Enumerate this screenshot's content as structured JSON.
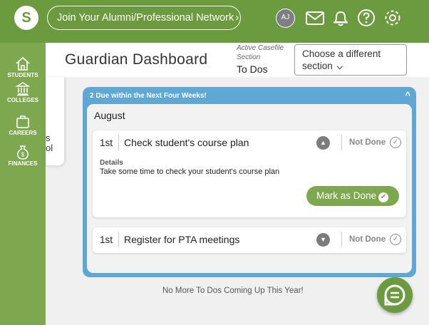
{
  "topbar": {
    "logo": "S",
    "network_button": "Join Your Alumni/Professional Network",
    "network_chevron": "›",
    "avatar_initials": "AJ",
    "icons": [
      "mail-icon",
      "bell-icon",
      "help-icon",
      "gear-icon"
    ]
  },
  "sidebar": {
    "items": [
      {
        "label": "STUDENTS",
        "icon": "home-icon"
      },
      {
        "label": "COLLEGES",
        "icon": "college-icon"
      },
      {
        "label": "CAREERS",
        "icon": "briefcase-icon"
      },
      {
        "label": "FINANCES",
        "icon": "money-bag-icon"
      }
    ]
  },
  "header": {
    "title": "Guardian Dashboard",
    "casefile_label_line1": "Active Casefile",
    "casefile_label_line2": "Section",
    "casefile_value": "To Dos",
    "section_select_line1": "Choose a different",
    "section_select_line2": "section"
  },
  "background_card": {
    "fragment1": "s",
    "fragment2": "ol"
  },
  "todo": {
    "heading": "2 Due within the Next Four Weeks!",
    "collapse_symbol": "^",
    "month": "August",
    "tasks": [
      {
        "date": "1st",
        "title": "Check student's course plan",
        "status": "Not Done",
        "expanded": true,
        "details_label": "Details",
        "details_text": "Take some time to check your student's course plan",
        "action": "Mark as Done"
      },
      {
        "date": "1st",
        "title": "Register for PTA meetings",
        "status": "Not Done",
        "expanded": false
      }
    ]
  },
  "footer_message": "No More To Dos Coming Up This Year!",
  "colors": {
    "brand_green": "#6c9a3e",
    "sidebar_green": "#7ea84f",
    "panel_blue": "#5fa8d3"
  }
}
